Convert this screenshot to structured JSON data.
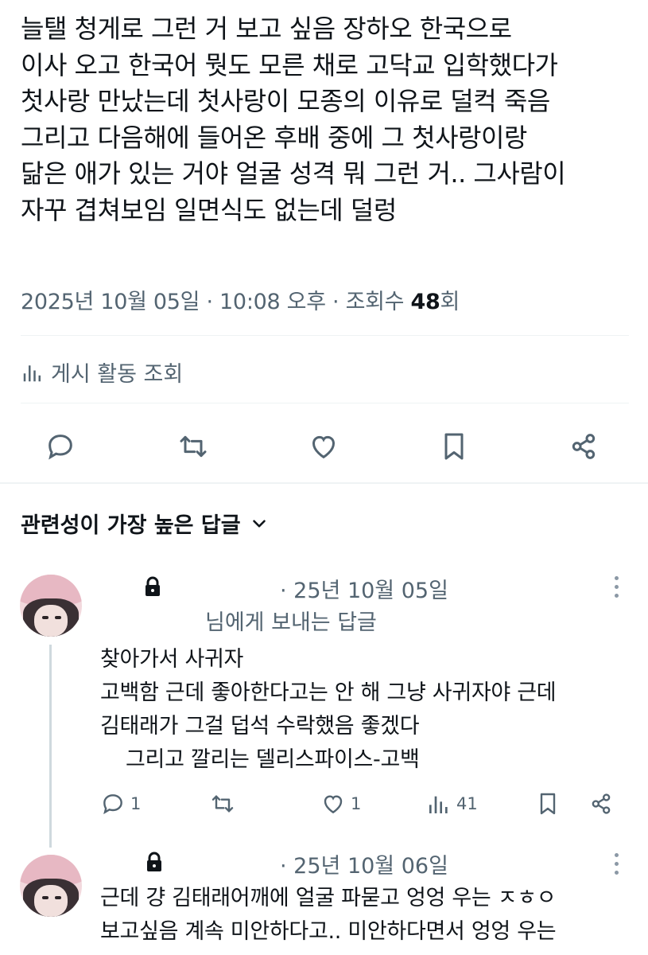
{
  "post": {
    "lines": [
      "늘탤 청게로 그런 거 보고 싶음 장하오 한국으로",
      "이사 오고 한국어 뭣도 모른 채로 고닥교 입학했다가",
      "첫사랑 만났는데 첫사랑이 모종의 이유로 덜컥 죽음",
      "그리고 다음해에 들어온 후배 중에 그 첫사랑이랑",
      "닮은 애가 있는 거야 얼굴 성격 뭐 그런 거.. 그사람이",
      "자꾸 겹쳐보임 일면식도 없는데 덜렁"
    ],
    "timestamp": "2025년 10월 05일 · 10:08 오후 · 조회수 ",
    "views_count": "48",
    "views_suffix": "회",
    "activity_label": "게시 활동 조회"
  },
  "icons": {
    "reply": "reply-icon",
    "retweet": "retweet-icon",
    "like": "heart-icon",
    "bookmark": "bookmark-icon",
    "share": "share-icon",
    "chart": "bar-chart-icon",
    "chevron": "chevron-down-icon",
    "lock": "lock-icon",
    "more": "more-vertical-icon"
  },
  "replies_sort_label": "관련성이 가장 높은 답글",
  "replies": [
    {
      "date": "· 25년 10월 05일",
      "replying_to": "님에게 보내는 답글",
      "lines": [
        "찾아가서 사귀자",
        "고백함 근데 좋아한다고는 안 해 그냥 사귀자야 근데",
        "김태래가 그걸 덥석 수락했음 좋겠다",
        "    그리고 깔리는 델리스파이스-고백"
      ],
      "reply_count": "1",
      "like_count": "1",
      "view_count": "41"
    },
    {
      "date": "· 25년 10월 06일",
      "lines": [
        "근데 걍 김태래어깨에 얼굴 파묻고 엉엉 우는 ㅈㅎㅇ",
        "보고싶음 계속 미안하다고.. 미안하다면서 엉엉 우는"
      ]
    }
  ],
  "colors": {
    "text": "#0f1419",
    "secondary": "#536471",
    "divider": "#eff3f4",
    "thread_line": "#cfd9de"
  }
}
